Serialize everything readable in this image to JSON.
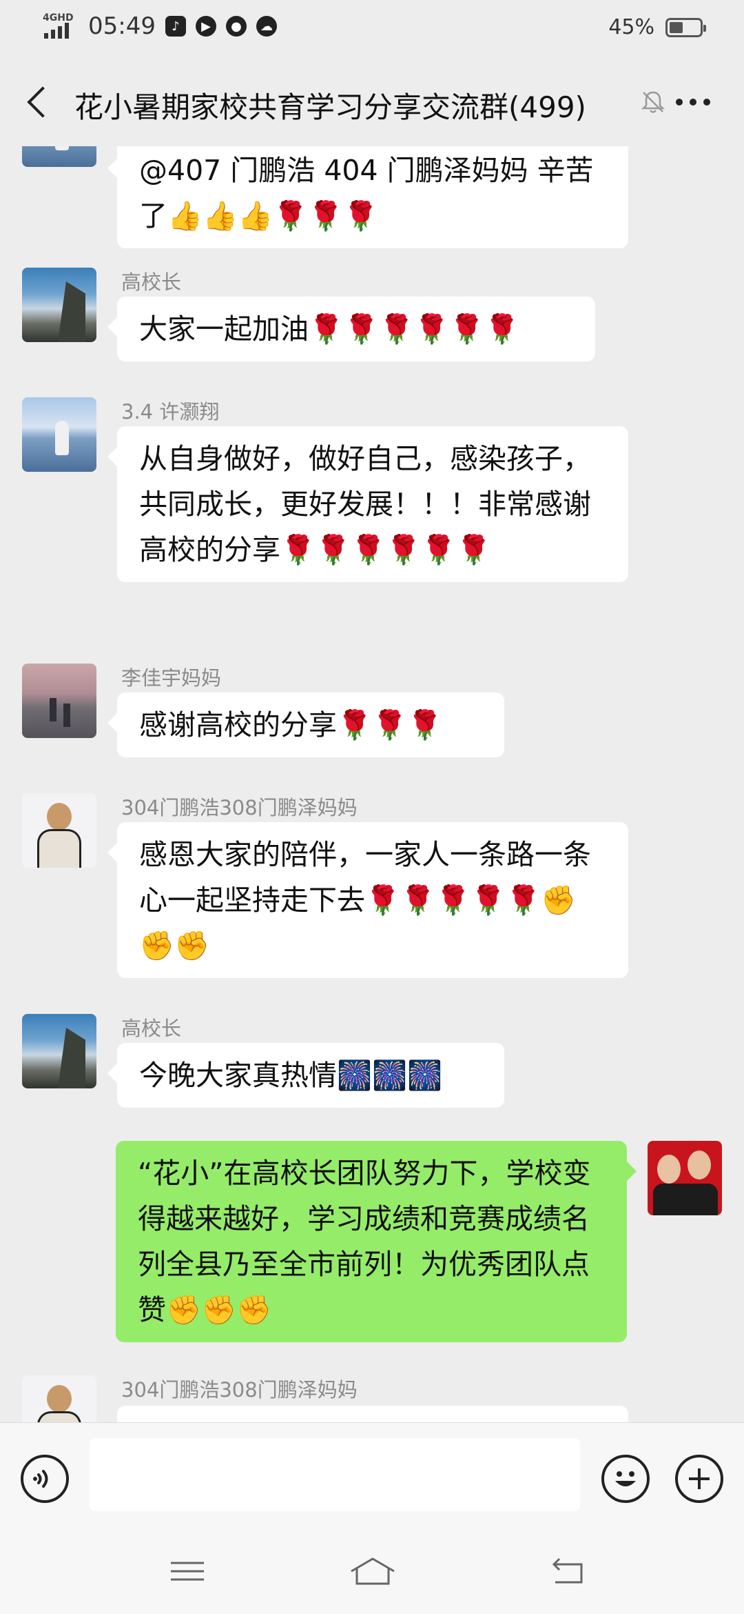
{
  "status_bar": {
    "network": "4GHD",
    "time": "05:49",
    "battery_percent": "45%",
    "battery_level": 0.45,
    "notification_icons": [
      "tiktok-icon",
      "play-icon",
      "chat-icon",
      "cloud-icon"
    ]
  },
  "nav": {
    "title": "花小暑期家校共育学习分享交流群(499)",
    "icons": [
      "back-icon",
      "mute-bell-icon",
      "more-icon"
    ]
  },
  "messages": [
    {
      "sender": "",
      "text": "@407 门鹏浩 404 门鹏泽妈妈  辛苦了👍👍👍🌹🌹🌹",
      "mine": false
    },
    {
      "sender": "高校长",
      "text": "大家一起加油🌹🌹🌹🌹🌹🌹",
      "mine": false
    },
    {
      "sender": "3.4 许灏翔",
      "text": "从自身做好，做好自己，感染孩子，共同成长，更好发展！！！非常感谢高校的分享🌹🌹🌹🌹🌹🌹",
      "mine": false
    },
    {
      "sender": "李佳宇妈妈",
      "text": "感谢高校的分享🌹🌹🌹",
      "mine": false
    },
    {
      "sender": "304门鹏浩308门鹏泽妈妈",
      "text": "感恩大家的陪伴，一家人一条路一条心一起坚持走下去🌹🌹🌹🌹🌹✊✊✊",
      "mine": false
    },
    {
      "sender": "高校长",
      "text": "今晚大家真热情🎆🎆🎆",
      "mine": false
    },
    {
      "sender": "",
      "text": "“花小”在高校长团队努力下，学校变得越来越好，学习成绩和竞赛成绩名列全县乃至全市前列！为优秀团队点赞✊✊✊",
      "mine": true
    },
    {
      "sender": "304门鹏浩308门鹏泽妈妈",
      "text": "",
      "mine": false
    }
  ],
  "input_bar": {
    "placeholder": "",
    "icons": [
      "voice-icon",
      "emoji-icon",
      "plus-icon"
    ]
  },
  "system_nav": {
    "icons": [
      "menu-icon",
      "home-icon",
      "back-arrow-icon"
    ]
  },
  "colors": {
    "background": "#ededed",
    "my_bubble": "#95ec69",
    "other_bubble": "#ffffff",
    "sender_name": "#8a8a8a"
  }
}
